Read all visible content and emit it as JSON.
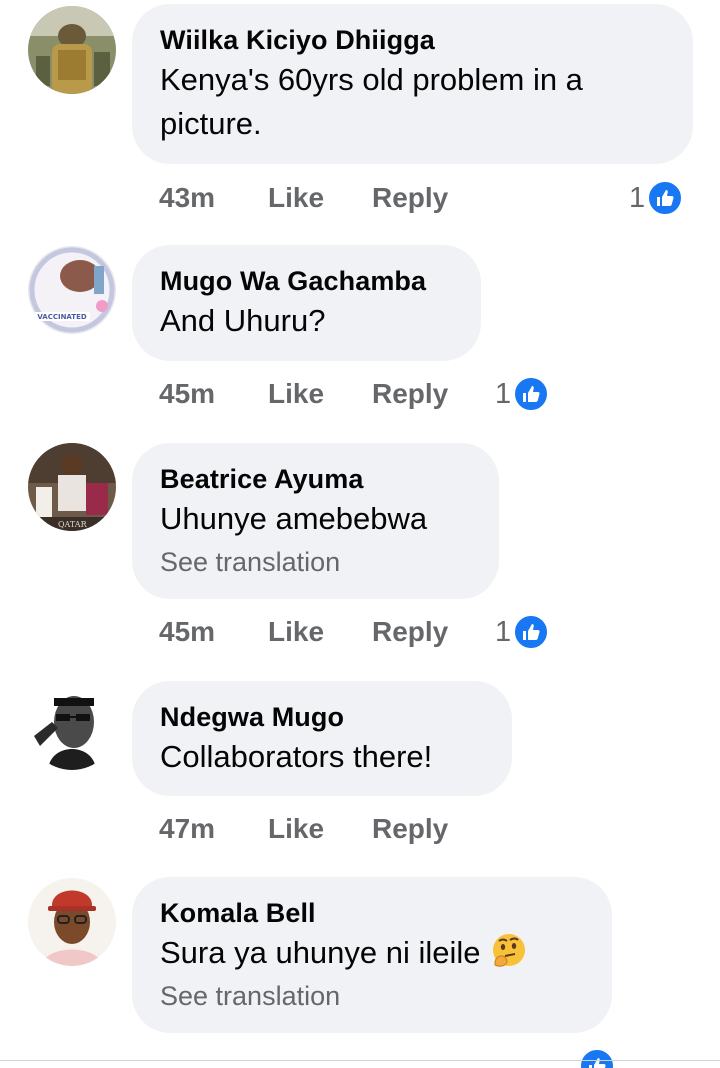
{
  "comments": [
    {
      "author": "Wiilka Kiciyo Dhiigga",
      "text_line1": "Kenya's 60yrs old problem in a",
      "text_line2": "picture.",
      "time": "43m",
      "like": "Like",
      "reply": "Reply",
      "reaction_count": "1",
      "reaction_icon": "like-icon"
    },
    {
      "author": "Mugo Wa Gachamba",
      "text": "And Uhuru?",
      "avatar_badge": "VACCINATED",
      "time": "45m",
      "like": "Like",
      "reply": "Reply",
      "reaction_count": "1",
      "reaction_icon": "like-icon"
    },
    {
      "author": "Beatrice Ayuma",
      "text": "Uhunye amebebwa",
      "see_translation": "See translation",
      "time": "45m",
      "like": "Like",
      "reply": "Reply",
      "reaction_count": "1",
      "reaction_icon": "like-icon"
    },
    {
      "author": "Ndegwa Mugo",
      "text": "Collaborators there!",
      "time": "47m",
      "like": "Like",
      "reply": "Reply"
    },
    {
      "author": "Komala Bell",
      "text": "Sura ya uhunye ni ileile",
      "text_emoji": "thinking-face-emoji",
      "see_translation": "See translation",
      "time": "",
      "like": "",
      "reply": "",
      "reaction_count": "",
      "reaction_icon": "like-icon"
    }
  ],
  "colors": {
    "bubble_bg": "#f0f2f5",
    "meta_text": "#65676b",
    "like_blue": "#1877f2",
    "author_text": "#050505"
  }
}
